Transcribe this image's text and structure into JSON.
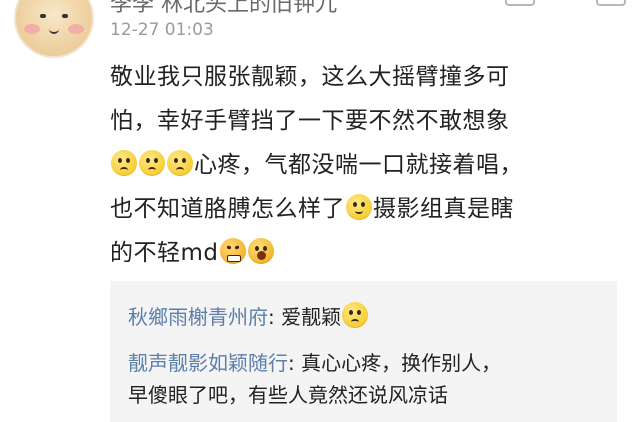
{
  "comment": {
    "username": "李李 林北头上的旧钟九",
    "timestamp": "12-27 01:03",
    "text": {
      "line1": "敬业我只服张靓颖，这么大摇臂撞多可",
      "line2": "怕，幸好手臂挡了一下要不然不敢想象",
      "line3": "心疼，气都没喘一口就接着唱，",
      "line4a": "也不知道胳膊怎么样了",
      "line4b": "摄影组真是瞎",
      "line5": "的不轻md"
    },
    "emojis": [
      "pleading-icon",
      "pleading-icon",
      "pleading-icon",
      "relieved-icon",
      "angry-icon",
      "shout-icon"
    ]
  },
  "replies": [
    {
      "author": "秋鄉雨榭青州府",
      "separator": ": ",
      "text": "爱靓颖",
      "emoji": "pleading-icon"
    },
    {
      "author": "靓声靓影如颖随行",
      "separator": ": ",
      "text": "真心心疼，换作别人，",
      "text2": "早傻眼了吧，有些人竟然还说风凉话"
    }
  ]
}
